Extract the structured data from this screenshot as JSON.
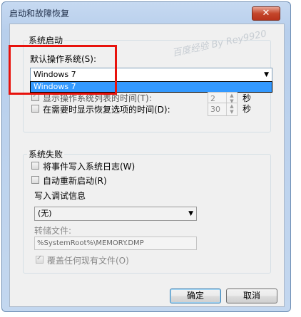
{
  "window": {
    "title": "启动和故障恢复",
    "close_label": "✕"
  },
  "system_startup": {
    "group_title": "系统启动",
    "default_os_label": "默认操作系统(S):",
    "default_os_value": "Windows 7",
    "dropdown_option": "Windows 7",
    "show_os_list_label": "显示操作系统列表的时间(T):",
    "show_os_list_value": "2",
    "show_recovery_label": "在需要时显示恢复选项的时间(D):",
    "show_recovery_value": "30",
    "seconds_unit_1": "秒",
    "seconds_unit_2": "秒"
  },
  "system_failure": {
    "group_title": "系统失败",
    "write_event_label": "将事件写入系统日志(W)",
    "auto_restart_label": "自动重新启动(R)",
    "debug_info_label": "写入调试信息",
    "debug_info_value": "(无)",
    "dump_file_label": "转储文件:",
    "dump_file_value": "%SystemRoot%\\MEMORY.DMP",
    "overwrite_label": "覆盖任何现有文件(O)"
  },
  "buttons": {
    "ok": "确定",
    "cancel": "取消"
  },
  "watermark": "百度经验 By Rey9920"
}
